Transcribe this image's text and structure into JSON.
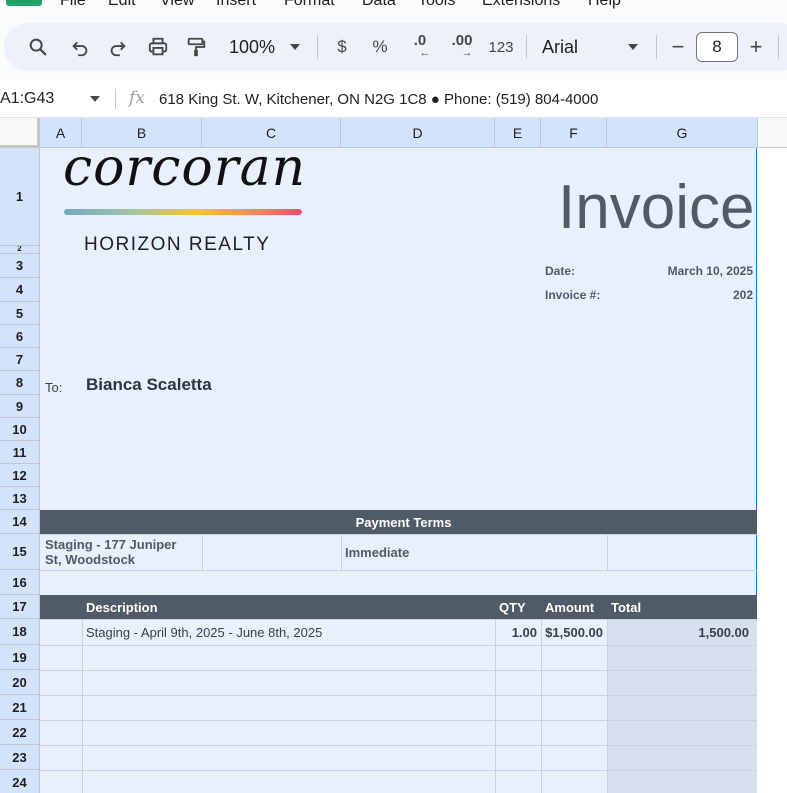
{
  "menu": {
    "items": [
      "File",
      "Edit",
      "View",
      "Insert",
      "Format",
      "Data",
      "Tools",
      "Extensions",
      "Help"
    ],
    "brand_color": "#1fa463"
  },
  "toolbar": {
    "icons": [
      "search-icon",
      "undo-icon",
      "redo-icon",
      "print-icon",
      "paint-format-icon"
    ],
    "zoom": "100%",
    "currency_label": "$",
    "percent_label": "%",
    "decrease_decimal_label": ".0",
    "increase_decimal_label": ".00",
    "number_format_label": "123",
    "font": "Arial",
    "font_size": "8",
    "minus_label": "−",
    "plus_label": "+"
  },
  "formula_bar": {
    "name_box": "A1:G43",
    "fx_label": "fx",
    "value": "618 King St. W, Kitchener, ON  N2G 1C8 ● Phone:  (519) 804-4000"
  },
  "grid": {
    "columns": [
      "A",
      "B",
      "C",
      "D",
      "E",
      "F",
      "G"
    ],
    "rows": [
      "1",
      "2",
      "3",
      "4",
      "5",
      "6",
      "7",
      "8",
      "9",
      "10",
      "11",
      "12",
      "13",
      "14",
      "15",
      "16",
      "17",
      "18",
      "19",
      "20",
      "21",
      "22",
      "23",
      "24"
    ]
  },
  "invoice": {
    "logo_word": "corcoran",
    "logo_sub": "HORIZON REALTY",
    "title": "Invoice",
    "date_label": "Date:",
    "date_value": "March 10, 2025",
    "invoice_no_label": "Invoice #:",
    "invoice_no_value": "202",
    "to_label": "To:",
    "to_name": "Bianca Scaletta",
    "payment_terms_header": "Payment Terms",
    "terms_line1": "Staging - 177 Juniper",
    "terms_line2": "St, Woodstock",
    "terms_value": "Immediate",
    "items_header": {
      "description": "Description",
      "qty": "QTY",
      "amount": "Amount",
      "total": "Total"
    },
    "items": [
      {
        "description": "Staging - April 9th, 2025 - June 8th, 2025",
        "qty": "1.00",
        "amount": "$1,500.00",
        "total": "1,500.00"
      }
    ]
  },
  "colors": {
    "header_band": "#4f5b66",
    "sheet_fill": "#e8f0fe",
    "selection": "#1a73e8",
    "total_column": "#d6e0ee"
  }
}
